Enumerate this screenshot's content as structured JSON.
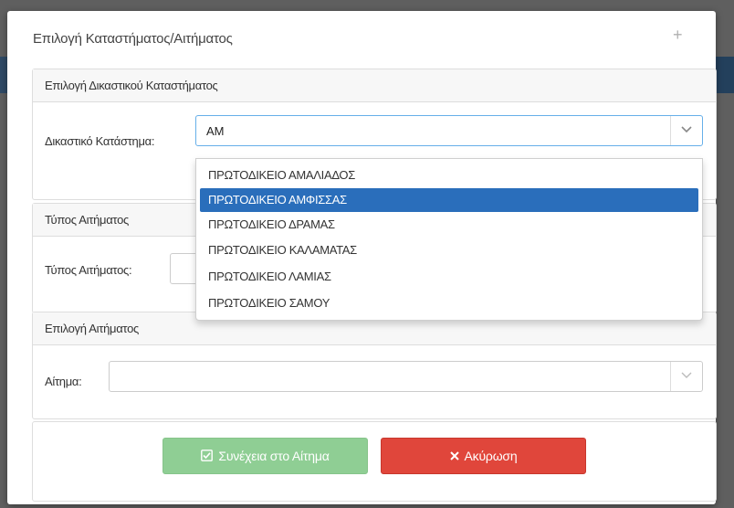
{
  "modal": {
    "title": "Επιλογή Καταστήματος/Αιτήματος",
    "close_glyph": "+"
  },
  "store_panel": {
    "heading": "Επιλογή Δικαστικού Καταστήματος",
    "field_label": "Δικαστικό Κατάστημα:",
    "field_value": "ΑΜ",
    "dropdown_options": [
      "ΠΡΩΤΟΔΙΚΕΙΟ ΑΜΑΛΙΑΔΟΣ",
      "ΠΡΩΤΟΔΙΚΕΙΟ ΑΜΦΙΣΣΑΣ",
      "ΠΡΩΤΟΔΙΚΕΙΟ ΔΡΑΜΑΣ",
      "ΠΡΩΤΟΔΙΚΕΙΟ ΚΑΛΑΜΑΤΑΣ",
      "ΠΡΩΤΟΔΙΚΕΙΟ ΛΑΜΙΑΣ",
      "ΠΡΩΤΟΔΙΚΕΙΟ ΣΑΜΟΥ"
    ],
    "highlighted_option": "ΠΡΩΤΟΔΙΚΕΙΟ ΑΜΦΙΣΣΑΣ"
  },
  "type_panel": {
    "heading": "Τύπος Αιτήματος",
    "field_label": "Τύπος Αιτήματος:"
  },
  "request_panel": {
    "heading": "Επιλογή Αιτήματος",
    "field_label": "Αίτημα:",
    "field_value": ""
  },
  "buttons": {
    "continue_label": "Συνέχεια στο Αίτημα",
    "cancel_label": "Ακύρωση",
    "continue_icon": "checkbox-icon",
    "cancel_icon": "x-icon"
  },
  "colors": {
    "highlight": "#2a6ebb",
    "continue_button": "#8fce94",
    "cancel_button": "#e0463b"
  }
}
